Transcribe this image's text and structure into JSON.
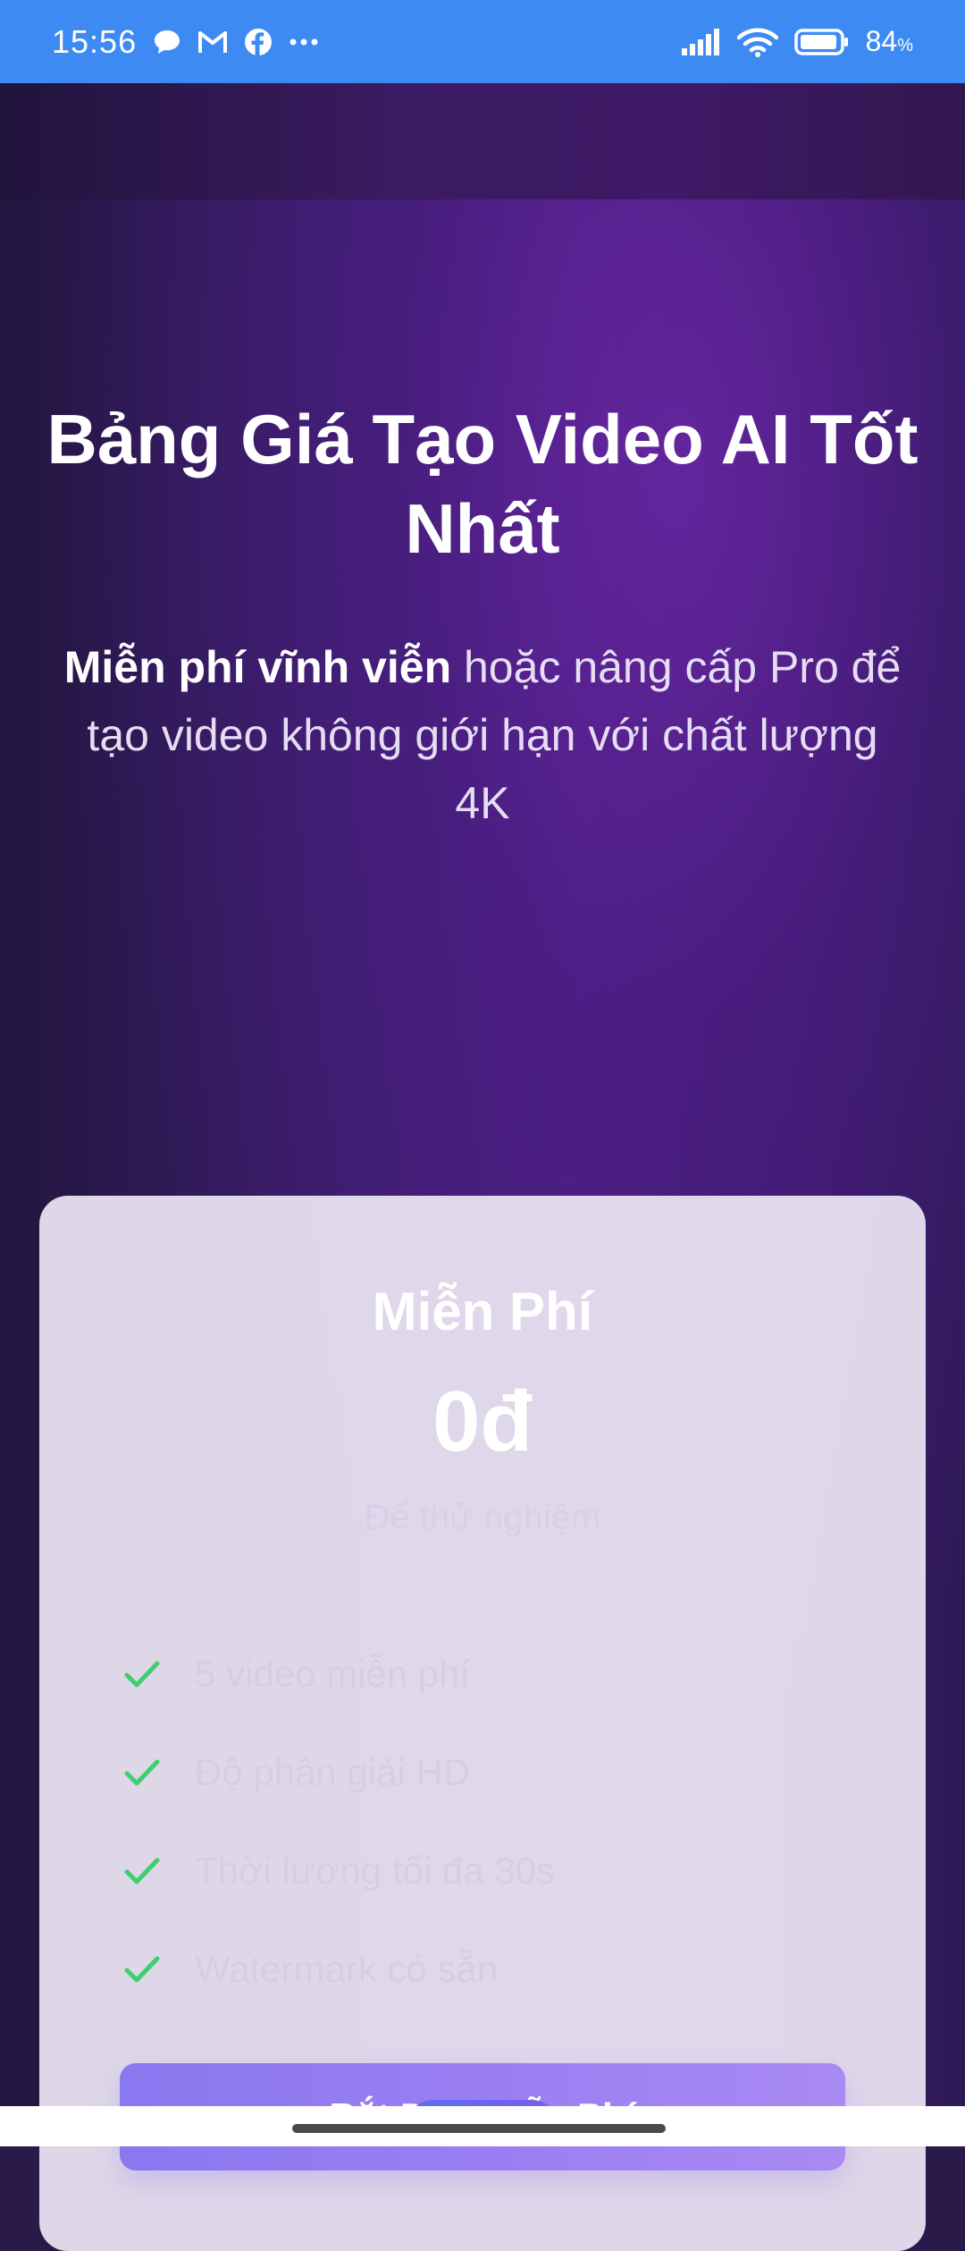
{
  "status_bar": {
    "time": "15:56",
    "battery": "84",
    "battery_unit": "%",
    "icons": [
      "chat-icon",
      "gmail-icon",
      "facebook-icon",
      "more-dots-icon",
      "signal-icon",
      "wifi-icon",
      "battery-icon"
    ]
  },
  "hero": {
    "title": "Bảng Giá Tạo Video AI Tốt Nhất",
    "subtitle_bold": "Miễn phí vĩnh viễn",
    "subtitle_rest": " hoặc nâng cấp Pro để tạo video không giới hạn với chất lượng 4K"
  },
  "plan": {
    "name": "Miễn Phí",
    "price": "0đ",
    "description": "Để thử nghiệm",
    "features": [
      "5 video miễn phí",
      "Độ phân giải HD",
      "Thời lượng tối đa 30s",
      "Watermark có sẵn"
    ],
    "cta_label": "Bắt Đầu Miễn Phí"
  },
  "colors": {
    "status_bar": "#3d8af2",
    "check": "#3ecf6e",
    "cta": "#9a7ef2"
  }
}
